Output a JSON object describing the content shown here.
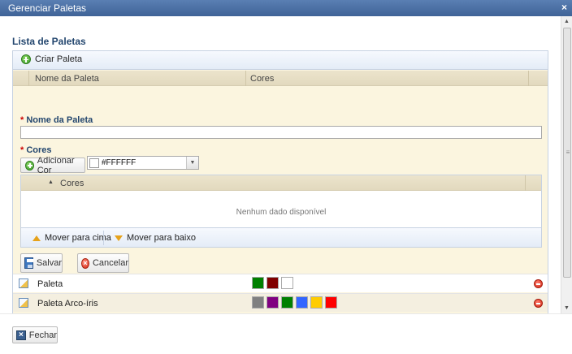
{
  "window": {
    "title": "Gerenciar Paletas",
    "close_glyph": "×"
  },
  "section_title": "Lista de Paletas",
  "toolbar": {
    "create_label": "Criar Paleta"
  },
  "columns": {
    "name": "Nome da Paleta",
    "colors": "Cores"
  },
  "form": {
    "name_label": "Nome da Paleta",
    "name_value": "",
    "colors_label": "Cores",
    "required_mark": "*",
    "add_color_label": "Adicionar Cor",
    "color_value": "#FFFFFF",
    "colors_grid": {
      "column": "Cores",
      "empty_text": "Nenhum dado disponível",
      "move_up_label": "Mover para cima",
      "move_down_label": "Mover para baixo"
    },
    "save_label": "Salvar",
    "cancel_label": "Cancelar"
  },
  "palettes": [
    {
      "name": "Paleta",
      "colors": [
        "#008000",
        "#800000",
        "#FFFFFF"
      ]
    },
    {
      "name": "Paleta Arco-íris",
      "colors": [
        "#808080",
        "#800080",
        "#008000",
        "#3366FF",
        "#FFCC00",
        "#FF0000"
      ]
    }
  ],
  "footer": {
    "close_label": "Fechar"
  },
  "icons": {
    "create": "plus-circle-icon",
    "save": "floppy-disk-icon",
    "cancel": "cancel-circle-icon",
    "edit": "edit-palette-icon",
    "delete": "minus-circle-icon",
    "close": "x-box-icon"
  }
}
